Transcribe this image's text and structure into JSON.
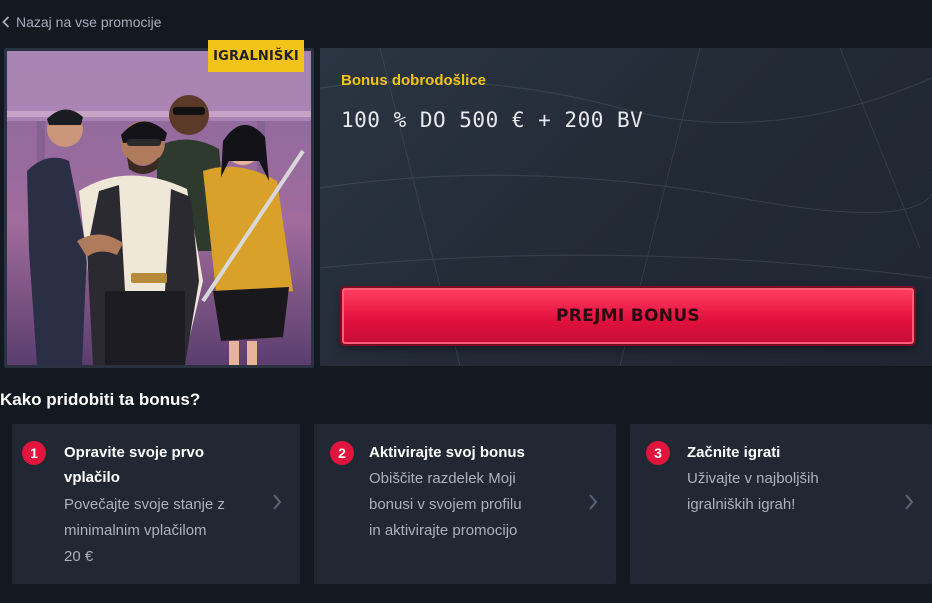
{
  "nav": {
    "back_label": "Nazaj na vse promocije",
    "back_icon": "chevron-left-icon"
  },
  "promo": {
    "badge": "IGRALNIŠKI",
    "subtitle": "Bonus dobrodošlice",
    "title": "100 % DO 500 € + 200 BV",
    "cta_label": "PREJMI BONUS",
    "colors": {
      "accent_yellow": "#f3c31a",
      "accent_red": "#e3123e",
      "panel": "#2b3542",
      "background": "#131921"
    }
  },
  "steps": {
    "heading": "Kako pridobiti ta bonus?",
    "items": [
      {
        "number": "1",
        "title": "Opravite svoje prvo vplačilo",
        "desc_lines": [
          "Povečajte svoje stanje z",
          "minimalnim vplačilom",
          "20 €"
        ],
        "arrow_icon": "chevron-right-icon"
      },
      {
        "number": "2",
        "title": "Aktivirajte svoj bonus",
        "desc_lines": [
          "Obiščite razdelek Moji",
          "bonusi v svojem profilu",
          "in aktivirajte promocijo"
        ],
        "arrow_icon": "chevron-right-icon"
      },
      {
        "number": "3",
        "title": "Začnite igrati",
        "desc_lines": [
          "Uživajte v najboljših",
          "igralniških igrah!"
        ],
        "arrow_icon": "chevron-right-icon"
      }
    ]
  }
}
